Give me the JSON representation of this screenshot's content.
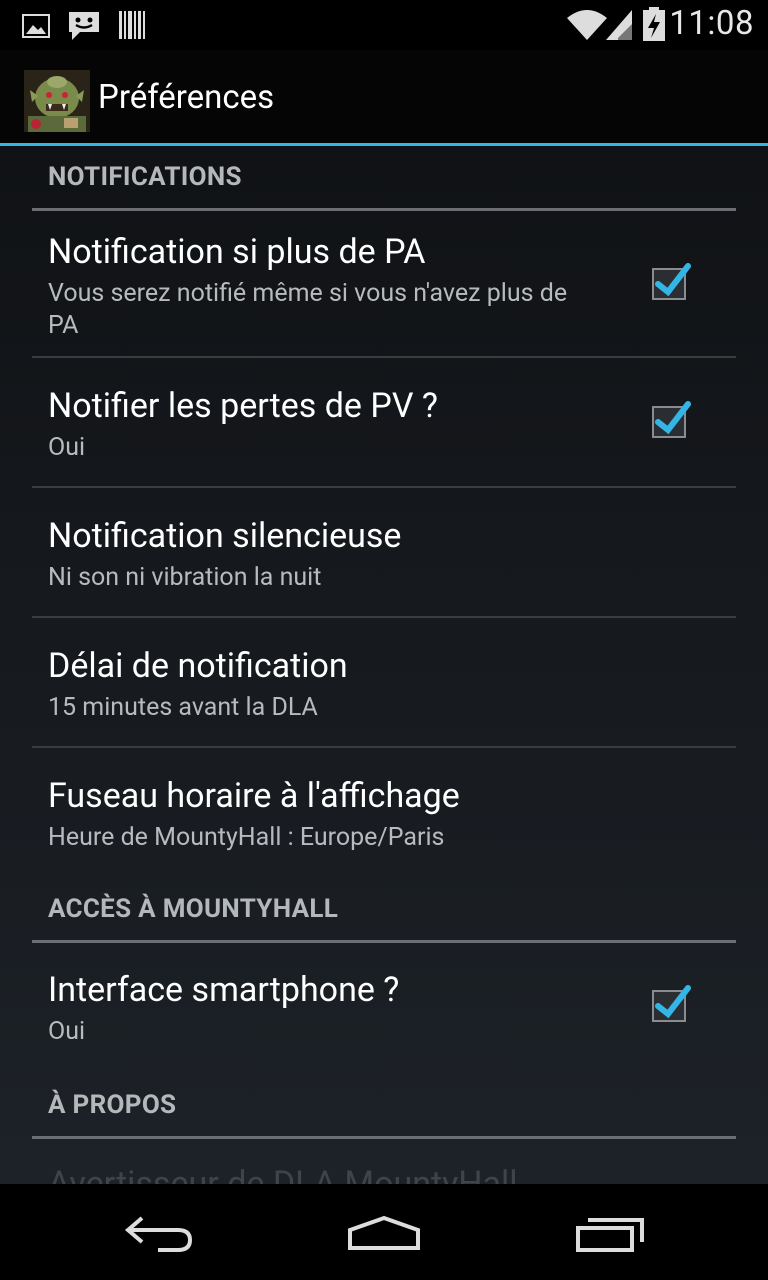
{
  "status_bar": {
    "time": "11:08",
    "icons": [
      "image-icon",
      "messenger-icon",
      "barcode-icon",
      "wifi-icon",
      "signal-icon",
      "battery-charging-icon"
    ]
  },
  "action_bar": {
    "title": "Préférences",
    "app_icon": "troll-app-icon"
  },
  "sections": [
    {
      "header": "NOTIFICATIONS",
      "items": [
        {
          "title": "Notification si plus de PA",
          "summary": "Vous serez notifié même si vous n'avez plus de PA",
          "checked": true
        },
        {
          "title": "Notifier les pertes de PV ?",
          "summary": "Oui",
          "checked": true
        },
        {
          "title": "Notification silencieuse",
          "summary": "Ni son ni vibration la nuit"
        },
        {
          "title": "Délai de notification",
          "summary": "15 minutes avant la DLA"
        },
        {
          "title": "Fuseau horaire à l'affichage",
          "summary": "Heure de MountyHall : Europe/Paris"
        }
      ]
    },
    {
      "header": "ACCÈS À MOUNTYHALL",
      "items": [
        {
          "title": "Interface smartphone ?",
          "summary": "Oui",
          "checked": true
        }
      ]
    },
    {
      "header": "À PROPOS",
      "items": [
        {
          "title": "Avertisseur de DLA MountyHall"
        }
      ]
    }
  ],
  "nav_bar": {
    "buttons": [
      "back-icon",
      "home-icon",
      "recent-apps-icon"
    ]
  },
  "colors": {
    "accent": "#33b5e5",
    "background_top": "#101215",
    "background_bottom": "#1d2228"
  }
}
